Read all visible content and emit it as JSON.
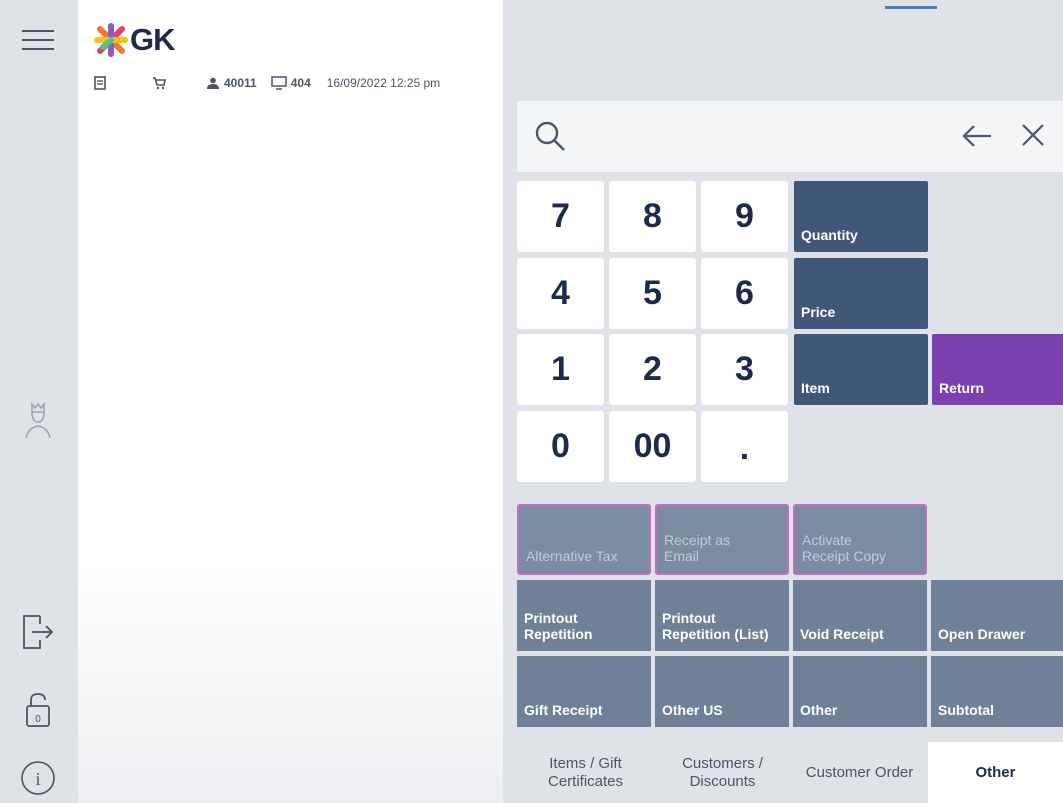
{
  "header": {
    "logo_text": "GK",
    "user_id": "40011",
    "terminal_id": "404",
    "datetime": "16/09/2022 12:25 pm"
  },
  "search": {
    "placeholder": ""
  },
  "keypad": {
    "k7": "7",
    "k8": "8",
    "k9": "9",
    "k4": "4",
    "k5": "5",
    "k6": "6",
    "k1": "1",
    "k2": "2",
    "k3": "3",
    "k0": "0",
    "k00": "00",
    "kdot": "."
  },
  "functions": {
    "quantity": "Quantity",
    "price": "Price",
    "item": "Item",
    "return": "Return"
  },
  "operations": {
    "alternative_tax": "Alternative Tax",
    "receipt_email_1": "Receipt as",
    "receipt_email_2": "Email",
    "activate_copy_1": "Activate",
    "activate_copy_2": "Receipt Copy",
    "printout_rep_1": "Printout",
    "printout_rep_2": "Repetition",
    "printout_list_1": "Printout",
    "printout_list_2": "Repetition (List)",
    "void_receipt": "Void Receipt",
    "open_drawer": "Open Drawer",
    "gift_receipt": "Gift Receipt",
    "other_us": "Other US",
    "other": "Other",
    "subtotal": "Subtotal"
  },
  "tabs": {
    "items_1": "Items / Gift",
    "items_2": "Certificates",
    "customers_1": "Customers /",
    "customers_2": "Discounts",
    "customer_order": "Customer Order",
    "other": "Other"
  },
  "colors": {
    "function_blue": "#3f5878",
    "return_purple": "#7c3fb0",
    "operation_gray": "#6e8198",
    "disabled_border": "#c86bc0"
  },
  "icons": [
    "menu-icon",
    "crown-icon",
    "logout-icon",
    "lock-icon",
    "info-icon",
    "receipt-icon",
    "cart-icon",
    "user-icon",
    "monitor-icon",
    "search-icon",
    "back-arrow-icon",
    "close-icon"
  ]
}
